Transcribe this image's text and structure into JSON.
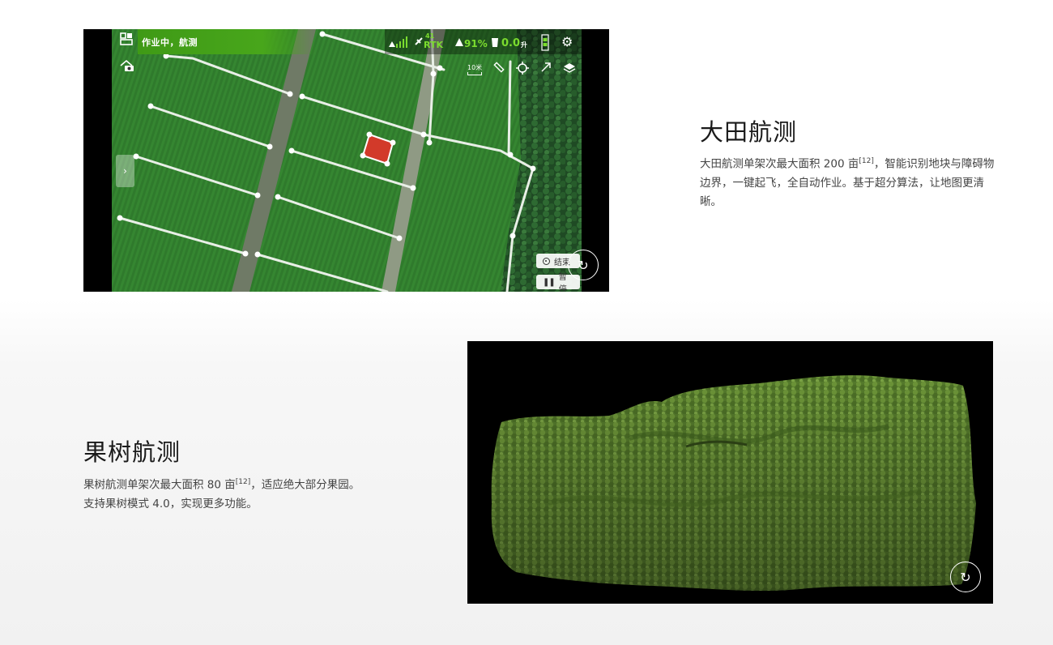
{
  "section_field": {
    "title": "大田航测",
    "desc_part1": "大田航测单架次最大面积 200 亩",
    "desc_ref": "[12]",
    "desc_part2": "，智能识别地块与障碍物边界，一键起飞，全自动作业。基于超分算法，让地图更清晰。",
    "app": {
      "status": "作业中，航测",
      "signal_count": "41",
      "rtk": "RTK",
      "battery": "91%",
      "speed": "0.0",
      "speed_unit": "升",
      "scale_label": "10米",
      "end_button": "结束",
      "pause_button": "暂停"
    }
  },
  "section_orchard": {
    "title": "果树航测",
    "desc_part1": "果树航测单架次最大面积 80 亩",
    "desc_ref": "[12]",
    "desc_part2": "，适应绝大部分果园。支持果树模式 4.0，实现更多功能。"
  },
  "colors": {
    "accent_green": "#7bdc2e",
    "status_bar": "#48a61b",
    "selected_plot": "#d23a2a"
  }
}
